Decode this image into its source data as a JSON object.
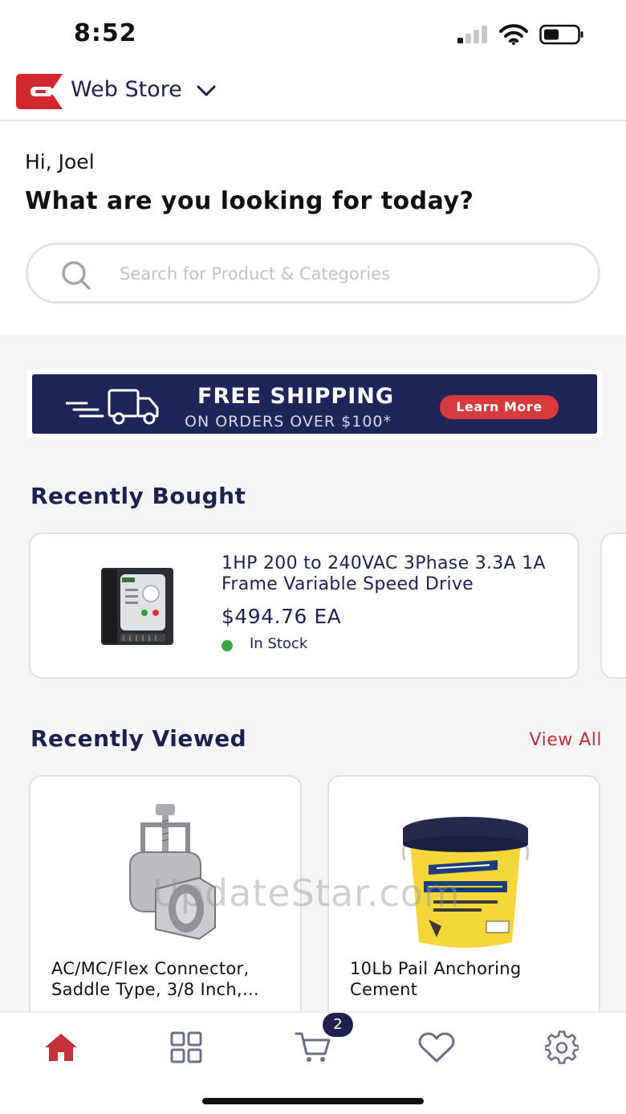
{
  "status_bar": {
    "time": "8:52"
  },
  "header": {
    "store_name": "Web Store",
    "icons": {
      "logo": "brand-logo",
      "dropdown": "chevron-down-icon"
    }
  },
  "welcome": {
    "greeting": "Hi, Joel",
    "headline": "What are you looking for today?"
  },
  "search": {
    "placeholder": "Search for Product & Categories",
    "value": ""
  },
  "banner": {
    "title": "FREE SHIPPING",
    "subtitle": "ON ORDERS OVER $100*",
    "button_label": "Learn More",
    "background_color": "#1f2459",
    "button_color": "#d93a3e"
  },
  "recently_bought": {
    "title": "Recently Bought",
    "items": [
      {
        "name": "1HP 200 to 240VAC 3Phase 3.3A 1A Frame Variable Speed Drive",
        "price": "$494.76 EA",
        "stock_status": "In Stock",
        "stock_color": "#3aa53f"
      }
    ]
  },
  "recently_viewed": {
    "title": "Recently Viewed",
    "view_all_label": "View All",
    "items": [
      {
        "name": "AC/MC/Flex Connector, Saddle Type, 3/8 Inch,..."
      },
      {
        "name": "10Lb Pail Anchoring Cement"
      }
    ]
  },
  "watermark": "UpdateStar.com",
  "tab_bar": {
    "cart_count": "2",
    "tabs": [
      "home-icon",
      "categories-grid-icon",
      "cart-icon",
      "heart-icon",
      "settings-gear-icon"
    ],
    "active_color": "#c3313a",
    "inactive_color": "#6b6f86"
  },
  "colors": {
    "brand_navy": "#1e2150",
    "brand_red": "#d0282e",
    "accent_red": "#c3313a"
  }
}
